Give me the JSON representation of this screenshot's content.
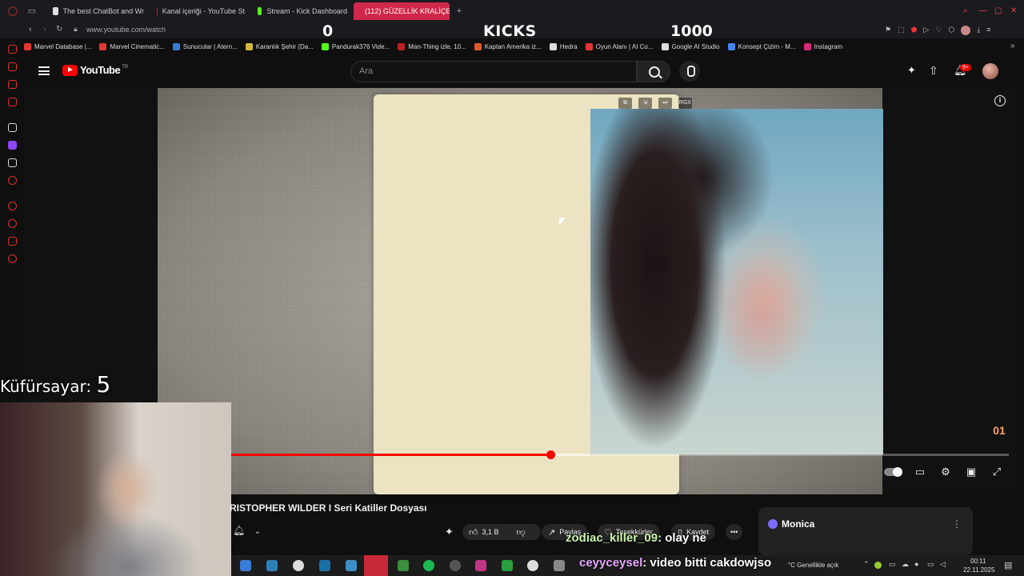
{
  "browser": {
    "tabs": [
      {
        "label": "The best ChatBot and Wr",
        "color": "#dddddd"
      },
      {
        "label": "Kanal içeriği - YouTube St",
        "color": "#ff0000"
      },
      {
        "label": "Stream - Kick Dashboard",
        "color": "#53fc18"
      },
      {
        "label": "(112) GÜZELLİK KRALİÇES",
        "color": "#ff0000",
        "active": true
      }
    ],
    "url": "www.youtube.com/watch",
    "bookmarks": [
      {
        "label": "Marvel Database |...",
        "color": "#e23636"
      },
      {
        "label": "Marvel Cinematic...",
        "color": "#e23636"
      },
      {
        "label": "Sunucular | Atern...",
        "color": "#3a7bd5"
      },
      {
        "label": "Karanlık Şehir (Da...",
        "color": "#d4b83a"
      },
      {
        "label": "Pandurak376 Vide...",
        "color": "#53fc18"
      },
      {
        "label": "Man-Thing izle, 10...",
        "color": "#b22"
      },
      {
        "label": "Kaptan Amerika iz...",
        "color": "#e05a2a"
      },
      {
        "label": "Hedra",
        "color": "#dddddd"
      },
      {
        "label": "Oyun Alanı | AI Co...",
        "color": "#e23636"
      },
      {
        "label": "Google AI Studio",
        "color": "#dddddd"
      },
      {
        "label": "Konsept Çizim - M...",
        "color": "#4285f4"
      },
      {
        "label": "Instagram",
        "color": "#d62976"
      }
    ]
  },
  "stream_overlay": {
    "left_number": "0",
    "kicks_label": "KICKS",
    "right_number": "1000",
    "curse_counter_label": "Küfürsayar:",
    "curse_counter_value": "5",
    "chat": [
      {
        "user": "zodiac_killer_09",
        "message": ": olay ne"
      },
      {
        "user": "ceyyceysel",
        "message": ": video bitti cakdowjso"
      }
    ]
  },
  "youtube": {
    "logo_text": "YouTube",
    "country_code": "TR",
    "search_placeholder": "Ara",
    "notification_count": "9+",
    "video_title": "RISTOPHER WILDER I Seri Katiller Dosyası",
    "progress_fraction": 0.41,
    "buffer_fraction": 0.46,
    "actions": {
      "like_count": "3,1 B",
      "share_label": "Paylaş",
      "thanks_label": "Teşekkürler",
      "save_label": "Kaydet"
    },
    "miniplayer_badge": "RGX",
    "watermark_text": "01"
  },
  "monica": {
    "title": "Monica"
  },
  "taskbar": {
    "weather": "°C  Genellikle açık",
    "time": "00:11",
    "date": "22.11.2025"
  }
}
